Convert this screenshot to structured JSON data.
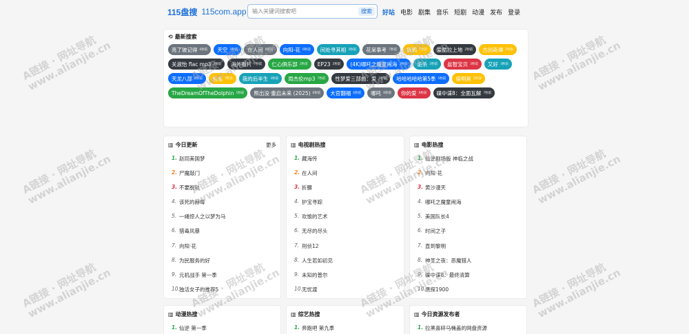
{
  "header": {
    "logo": "115盘搜",
    "domain": "115com.app",
    "search_placeholder": "输入关键词搜索吧",
    "search_button": "搜索",
    "nav": [
      "好站",
      "电影",
      "剧集",
      "音乐",
      "短剧",
      "动漫",
      "发布",
      "登录"
    ]
  },
  "latest": {
    "title": "最新搜索",
    "icon": "history-icon",
    "tags": [
      {
        "text": "亮了玻记得",
        "count": "6秒前",
        "color": "gray"
      },
      {
        "text": "天空",
        "count": "3秒前",
        "color": "blue"
      },
      {
        "text": "在人间",
        "count": "8秒前",
        "color": "gray"
      },
      {
        "text": "向阳-花",
        "count": "6秒前",
        "color": "blue"
      },
      {
        "text": "间处寻其相",
        "count": "3秒前",
        "color": "teal"
      },
      {
        "text": "花呆事考",
        "count": "7秒前",
        "color": "gray"
      },
      {
        "text": "袋鸦",
        "count": "7秒前",
        "color": "yellow"
      },
      {
        "text": "爱酷拉上地",
        "count": "2秒前",
        "color": "dark"
      },
      {
        "text": "古剑奇谭",
        "count": "2秒前",
        "color": "yellow"
      },
      {
        "text": "关淑怡 flac mp3",
        "count": "2秒前",
        "color": "dark"
      },
      {
        "text": "海外看片",
        "count": "7秒前",
        "color": "dark"
      },
      {
        "text": "仁心俱乐部",
        "count": "2秒前",
        "color": "green"
      },
      {
        "text": "EP23",
        "count": "2秒前",
        "color": "dark"
      },
      {
        "text": "(4K)哪吒之魔童闹海",
        "count": "3秒前",
        "color": "blue"
      },
      {
        "text": "诡杀",
        "count": "3秒前",
        "color": "teal"
      },
      {
        "text": "盐智宝贝",
        "count": "3秒前",
        "color": "red"
      },
      {
        "text": "又好",
        "count": "3秒前",
        "color": "teal"
      },
      {
        "text": "天龙八部",
        "count": "4秒前",
        "color": "blue"
      },
      {
        "text": "色戒",
        "count": "7秒前",
        "color": "yellow"
      },
      {
        "text": "我的后半生",
        "count": "3秒前",
        "color": "teal"
      },
      {
        "text": "周杰伦mp3",
        "count": "7秒前",
        "color": "green"
      },
      {
        "text": "性梦爱三部曲：爱",
        "count": "5秒前",
        "color": "dark"
      },
      {
        "text": "哈哈哈哈哈第5季",
        "count": "5秒前",
        "color": "blue"
      },
      {
        "text": "侯明昊",
        "count": "5秒前",
        "color": "yellow"
      },
      {
        "text": "TheDreamOfTheDolphin",
        "count": "5秒前",
        "color": "green"
      },
      {
        "text": "熊出没·重启未来 (2025)",
        "count": "6秒前",
        "color": "gray"
      },
      {
        "text": "大官翻福",
        "count": "6秒前",
        "color": "blue"
      },
      {
        "text": "哪吒",
        "count": "6秒前",
        "color": "gray"
      },
      {
        "text": "你的爱",
        "count": "6秒前",
        "color": "red"
      },
      {
        "text": "碟中谍8：全面瓦解",
        "count": "7秒前",
        "color": "dark"
      }
    ]
  },
  "lists": [
    {
      "title": "今日更新",
      "more": "更多",
      "items": [
        "赵同美国梦",
        "尸魔敲门",
        "不要脱轨",
        "该死的赫每",
        "一绳惊人之以梦为马",
        "猎毒风暴",
        "向阳·花",
        "为民服务的好",
        "元机战手 第一季",
        "独活女子的推荐5"
      ]
    },
    {
      "title": "电视剧热搜",
      "more": "",
      "items": [
        "藏海传",
        "在人间",
        "折腰",
        "护宝寻踪",
        "欢愉的艺术",
        "无尽的尽头",
        "刑侦12",
        "人生若如初见",
        "未知的普尔",
        "无忧渡"
      ]
    },
    {
      "title": "电影热搜",
      "more": "",
      "items": [
        "仙逆剧场版 神临之战",
        "向阳·花",
        "黄沙漫天",
        "哪吒之魔童闹海",
        "美国队长4",
        "时间之子",
        "直到黎明",
        "神圣之夜：恶魔猎人",
        "碟中谍8：最终清算",
        "唐探1900"
      ]
    },
    {
      "title": "动漫热搜",
      "more": "",
      "items": [
        "仙逆 第一季"
      ]
    },
    {
      "title": "综艺热搜",
      "more": "",
      "items": [
        "奔跑吧 第九季"
      ]
    },
    {
      "title": "今日资源发布者",
      "more": "",
      "items": [
        "拉黑喜碎马桶盖的网盘资源"
      ]
    }
  ],
  "watermark": [
    "A链接 · 网址导航",
    "www.alianjie.cn"
  ]
}
